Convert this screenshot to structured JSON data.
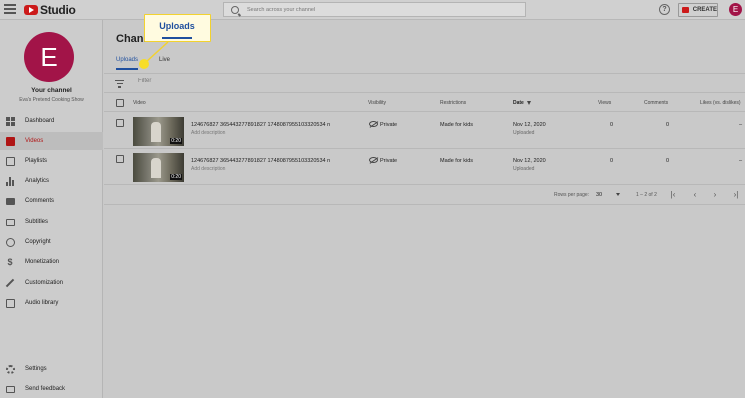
{
  "app": {
    "logo_text": "Studio"
  },
  "header": {
    "search_placeholder": "Search across your channel",
    "help_glyph": "?",
    "create_label": "CREATE",
    "avatar_letter": "E"
  },
  "sidebar": {
    "avatar_letter": "E",
    "channel_title": "Your channel",
    "channel_name": "Eva's Pretend Cooking Show",
    "items": [
      {
        "label": "Dashboard",
        "icon": "dashboard-icon"
      },
      {
        "label": "Videos",
        "icon": "videos-icon",
        "active": true
      },
      {
        "label": "Playlists",
        "icon": "playlists-icon"
      },
      {
        "label": "Analytics",
        "icon": "analytics-icon"
      },
      {
        "label": "Comments",
        "icon": "comments-icon"
      },
      {
        "label": "Subtitles",
        "icon": "subtitles-icon"
      },
      {
        "label": "Copyright",
        "icon": "copyright-icon"
      },
      {
        "label": "Monetization",
        "icon": "monetization-icon"
      },
      {
        "label": "Customization",
        "icon": "customization-icon"
      },
      {
        "label": "Audio library",
        "icon": "audio-library-icon"
      }
    ],
    "bottom_items": [
      {
        "label": "Settings",
        "icon": "gear-icon"
      },
      {
        "label": "Send feedback",
        "icon": "feedback-icon"
      }
    ]
  },
  "main": {
    "page_title": "Channel",
    "tabs": [
      {
        "label": "Uploads",
        "active": true
      },
      {
        "label": "Live",
        "active": false
      }
    ],
    "filter_placeholder": "Filter",
    "columns": {
      "video": "Video",
      "visibility": "Visibility",
      "restrictions": "Restrictions",
      "date": "Date",
      "views": "Views",
      "comments": "Comments",
      "likes": "Likes (vs. dislikes)"
    },
    "rows": [
      {
        "title": "124676827 365443277891827 174808795510332053​4 n",
        "description": "Add description",
        "duration": "0:20",
        "visibility": "Private",
        "restrictions": "Made for kids",
        "date": "Nov 12, 2020",
        "date_status": "Uploaded",
        "views": "0",
        "comments": "0",
        "likes": "–"
      },
      {
        "title": "124676827 365443277891827 174808795510332053​4 n",
        "description": "Add description",
        "duration": "0:20",
        "visibility": "Private",
        "restrictions": "Made for kids",
        "date": "Nov 12, 2020",
        "date_status": "Uploaded",
        "views": "0",
        "comments": "0",
        "likes": "–"
      }
    ],
    "pagination": {
      "rows_per_page_label": "Rows per page:",
      "rows_per_page": "30",
      "range": "1 – 2 of 2"
    }
  },
  "callout": {
    "label": "Uploads",
    "border_color": "#f2d22f",
    "dot_color": "#f7dd2a"
  },
  "colors": {
    "accent_blue": "#1f4f9e",
    "brand_red": "#cc1a1a",
    "avatar": "#a21448"
  }
}
